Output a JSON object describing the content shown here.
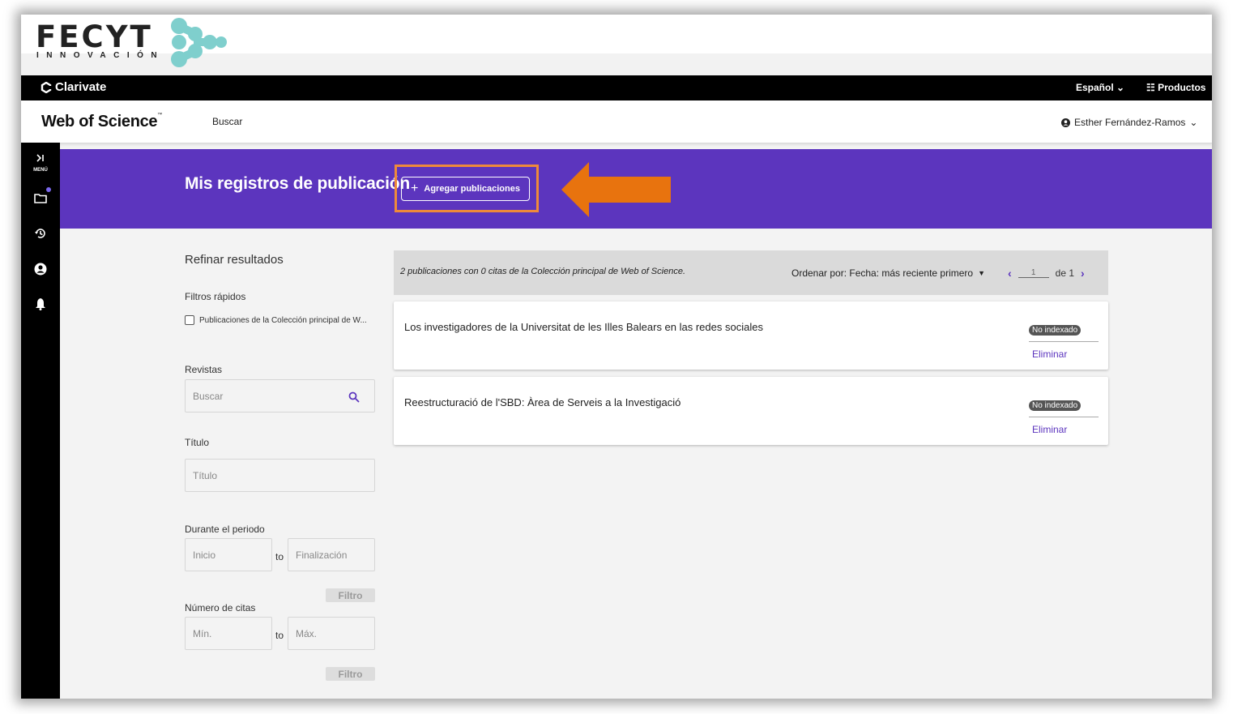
{
  "fecyt": {
    "wordmark": "FECYT",
    "sub": "INNOVACIÓN"
  },
  "topbar": {
    "brand": "Clarivate",
    "language": "Español",
    "products": "Productos"
  },
  "navbar": {
    "product": "Web of Science",
    "trademark": "™",
    "search_link": "Buscar",
    "user_name": "Esther Fernández-Ramos"
  },
  "sidebar": {
    "menu_label": "MENÚ"
  },
  "banner": {
    "title": "Mis registros de publicación",
    "add_button": "Agregar publicaciones"
  },
  "filters": {
    "title": "Refinar resultados",
    "quick_filters": {
      "label": "Filtros rápidos",
      "checkbox_label": "Publicaciones de la Colección principal de W..."
    },
    "journals": {
      "label": "Revistas",
      "placeholder": "Buscar"
    },
    "title_filter": {
      "label": "Título",
      "placeholder": "Título"
    },
    "period": {
      "label": "Durante el periodo",
      "start_placeholder": "Inicio",
      "to": "to",
      "end_placeholder": "Finalización",
      "button": "Filtro"
    },
    "citations": {
      "label": "Número de citas",
      "min_placeholder": "Mín.",
      "to": "to",
      "max_placeholder": "Máx.",
      "button": "Filtro"
    }
  },
  "results": {
    "summary": "2 publicaciones con 0 citas de la Colección principal de Web of Science.",
    "sort_label": "Ordenar por: Fecha: más reciente primero",
    "page_current": "1",
    "page_of": "de 1",
    "items": [
      {
        "title": "Los investigadores de la Universitat de les Illes Balears en las redes sociales",
        "status": "No indexado",
        "action": "Eliminar"
      },
      {
        "title": "Reestructuració de l'SBD: Àrea de Serveis a la Investigació",
        "status": "No indexado",
        "action": "Eliminar"
      }
    ]
  },
  "colors": {
    "accent": "#5c35be",
    "highlight": "#ef8a3a",
    "arrow": "#e8730e",
    "logo": "#7fcfcd"
  }
}
